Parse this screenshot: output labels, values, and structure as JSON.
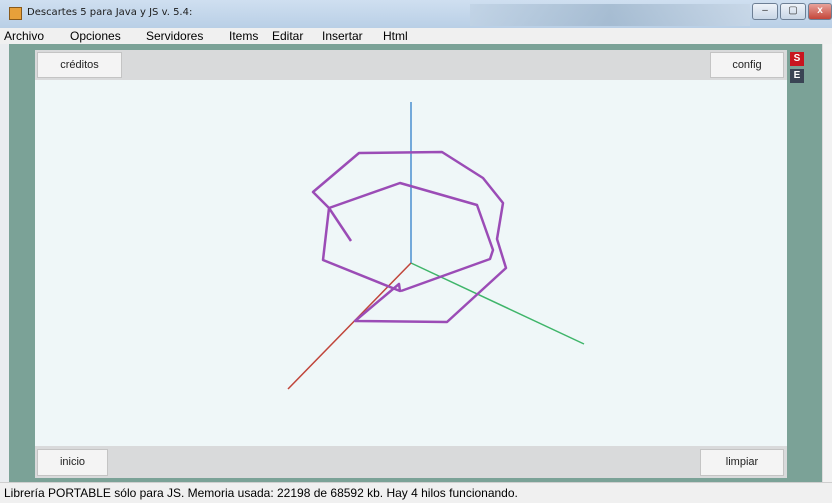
{
  "window": {
    "title": "Descartes 5 para Java y JS v. 5.4:",
    "minimize": "–",
    "maximize": "▢",
    "close": "x"
  },
  "menu": [
    "Archivo",
    "Opciones",
    "Servidores",
    "Items",
    "Editar",
    "Insertar",
    "Html"
  ],
  "panel_top": {
    "credits_label": "créditos",
    "config_label": "config"
  },
  "panel_bottom": {
    "start_label": "inicio",
    "clear_label": "limpiar"
  },
  "side_buttons": {
    "s": "S",
    "e": "E"
  },
  "status": "Librería PORTABLE sólo para JS. Memoria usada: 22198 de 68592 kb. Hay 4 hilos funcionando.",
  "colors": {
    "axis_x": "#3fb56a",
    "axis_y": "#4a8fd0",
    "axis_z": "#c0453a",
    "curve": "#9b4cb6",
    "canvas_bg": "#eff7f8",
    "frame": "#7ba297"
  }
}
